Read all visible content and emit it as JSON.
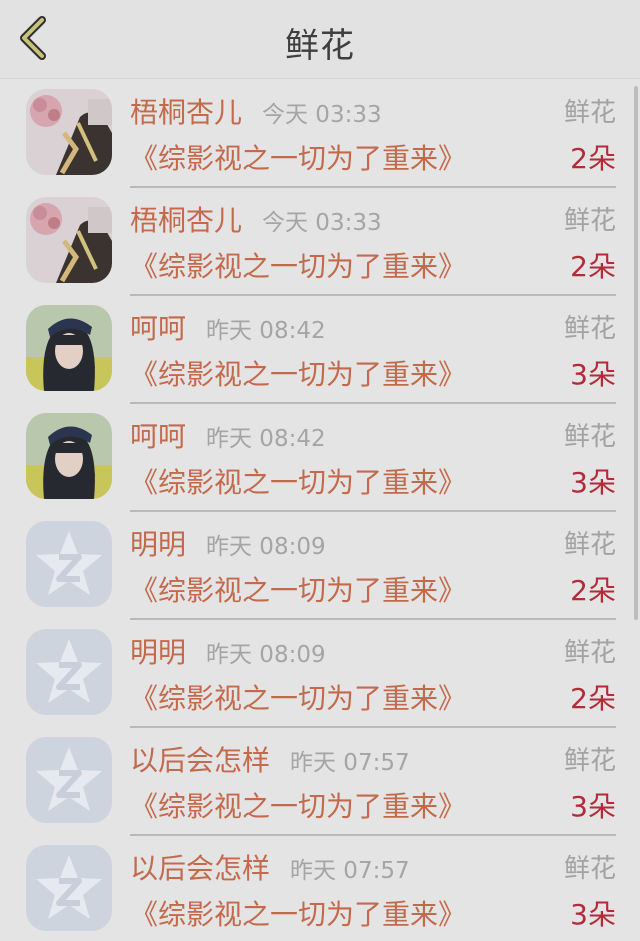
{
  "header": {
    "title": "鲜花",
    "back_icon": "chevron-left-icon",
    "accent": "#c9c27a"
  },
  "items": [
    {
      "name": "梧桐杏儿",
      "time": "今天 03:33",
      "kind": "鲜花",
      "book": "《综影视之一切为了重来》",
      "count": "2朵",
      "avatar": "flower-photo"
    },
    {
      "name": "梧桐杏儿",
      "time": "今天 03:33",
      "kind": "鲜花",
      "book": "《综影视之一切为了重来》",
      "count": "2朵",
      "avatar": "flower-photo"
    },
    {
      "name": "呵呵",
      "time": "昨天 08:42",
      "kind": "鲜花",
      "book": "《综影视之一切为了重来》",
      "count": "3朵",
      "avatar": "girl-photo"
    },
    {
      "name": "呵呵",
      "time": "昨天 08:42",
      "kind": "鲜花",
      "book": "《综影视之一切为了重来》",
      "count": "3朵",
      "avatar": "girl-photo"
    },
    {
      "name": "明明",
      "time": "昨天 08:09",
      "kind": "鲜花",
      "book": "《综影视之一切为了重来》",
      "count": "2朵",
      "avatar": "default-star-icon"
    },
    {
      "name": "明明",
      "time": "昨天 08:09",
      "kind": "鲜花",
      "book": "《综影视之一切为了重来》",
      "count": "2朵",
      "avatar": "default-star-icon"
    },
    {
      "name": "以后会怎样",
      "time": "昨天 07:57",
      "kind": "鲜花",
      "book": "《综影视之一切为了重来》",
      "count": "3朵",
      "avatar": "default-star-icon"
    },
    {
      "name": "以后会怎样",
      "time": "昨天 07:57",
      "kind": "鲜花",
      "book": "《综影视之一切为了重来》",
      "count": "3朵",
      "avatar": "default-star-icon"
    }
  ],
  "colors": {
    "name": "#c46a4c",
    "count": "#b42a37",
    "muted": "#a5a5a5",
    "background": "#e4e4e4"
  }
}
